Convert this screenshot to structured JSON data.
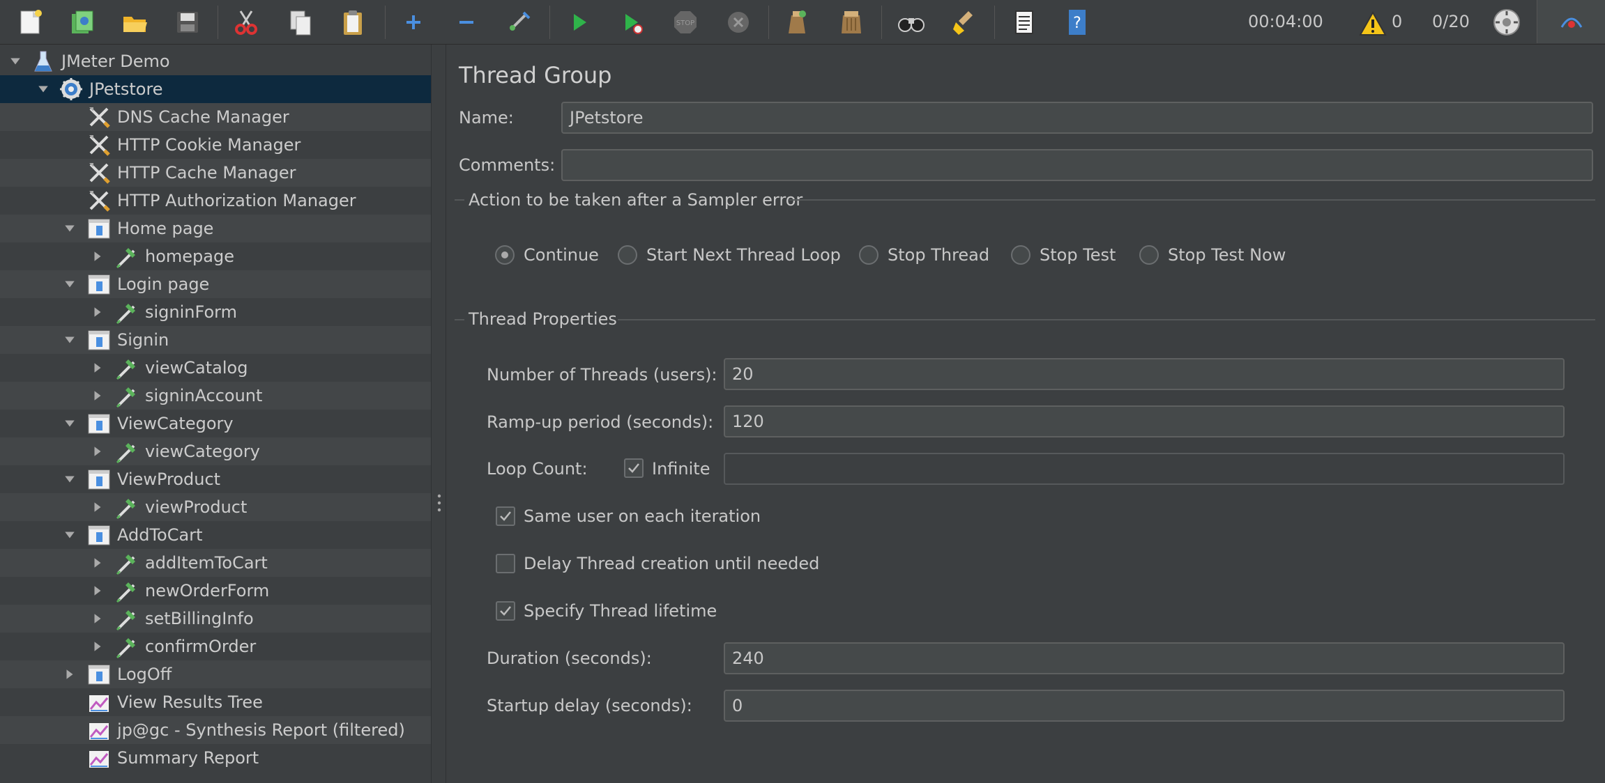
{
  "toolbar": {
    "icons": [
      "new-icon",
      "templates-icon",
      "open-icon",
      "save-icon",
      "cut-icon",
      "copy-icon",
      "paste-icon",
      "expand-icon",
      "collapse-icon",
      "toggle-icon",
      "start-icon",
      "start-no-pauses-icon",
      "stop-icon",
      "shutdown-icon",
      "clear-icon",
      "clear-all-icon",
      "search-icon",
      "reset-search-icon",
      "function-helper-icon",
      "help-icon"
    ],
    "elapsed_time": "00:04:00",
    "warning_count": "0",
    "thread_count": "0/20"
  },
  "tree": {
    "items": [
      {
        "label": "JMeter Demo",
        "icon": "test-plan-icon"
      },
      {
        "label": "JPetstore",
        "icon": "thread-group-icon"
      },
      {
        "label": "DNS Cache Manager",
        "icon": "config-element-icon"
      },
      {
        "label": "HTTP Cookie Manager",
        "icon": "config-element-icon"
      },
      {
        "label": "HTTP Cache Manager",
        "icon": "config-element-icon"
      },
      {
        "label": "HTTP Authorization Manager",
        "icon": "config-element-icon"
      },
      {
        "label": "Home page",
        "icon": "transaction-controller-icon"
      },
      {
        "label": "homepage",
        "icon": "sampler-icon"
      },
      {
        "label": "Login page",
        "icon": "transaction-controller-icon"
      },
      {
        "label": "signinForm",
        "icon": "sampler-icon"
      },
      {
        "label": "Signin",
        "icon": "transaction-controller-icon"
      },
      {
        "label": "viewCatalog",
        "icon": "sampler-icon"
      },
      {
        "label": "signinAccount",
        "icon": "sampler-icon"
      },
      {
        "label": "ViewCategory",
        "icon": "transaction-controller-icon"
      },
      {
        "label": "viewCategory",
        "icon": "sampler-icon"
      },
      {
        "label": "ViewProduct",
        "icon": "transaction-controller-icon"
      },
      {
        "label": "viewProduct",
        "icon": "sampler-icon"
      },
      {
        "label": "AddToCart",
        "icon": "transaction-controller-icon"
      },
      {
        "label": "addItemToCart",
        "icon": "sampler-icon"
      },
      {
        "label": "newOrderForm",
        "icon": "sampler-icon"
      },
      {
        "label": "setBillingInfo",
        "icon": "sampler-icon"
      },
      {
        "label": "confirmOrder",
        "icon": "sampler-icon"
      },
      {
        "label": "LogOff",
        "icon": "transaction-controller-icon"
      },
      {
        "label": "View Results Tree",
        "icon": "listener-icon"
      },
      {
        "label": "jp@gc - Synthesis Report (filtered)",
        "icon": "listener-icon"
      },
      {
        "label": "Summary Report",
        "icon": "listener-icon"
      }
    ]
  },
  "panel": {
    "title": "Thread Group",
    "name_label": "Name:",
    "name_value": "JPetstore",
    "comments_label": "Comments:",
    "comments_value": "",
    "error_action_title": "Action to be taken after a Sampler error",
    "error_actions": [
      {
        "label": "Continue",
        "selected": true
      },
      {
        "label": "Start Next Thread Loop",
        "selected": false
      },
      {
        "label": "Stop Thread",
        "selected": false
      },
      {
        "label": "Stop Test",
        "selected": false
      },
      {
        "label": "Stop Test Now",
        "selected": false
      }
    ],
    "thread_props_title": "Thread Properties",
    "threads_label": "Number of Threads (users):",
    "threads_value": "20",
    "rampup_label": "Ramp-up period (seconds):",
    "rampup_value": "120",
    "loop_label": "Loop Count:",
    "infinite_label": "Infinite",
    "infinite_checked": true,
    "loop_value": "",
    "same_user_label": "Same user on each iteration",
    "same_user_checked": true,
    "delay_label": "Delay Thread creation until needed",
    "delay_checked": false,
    "lifetime_label": "Specify Thread lifetime",
    "lifetime_checked": true,
    "duration_label": "Duration (seconds):",
    "duration_value": "240",
    "startup_label": "Startup delay (seconds):",
    "startup_value": "0"
  }
}
